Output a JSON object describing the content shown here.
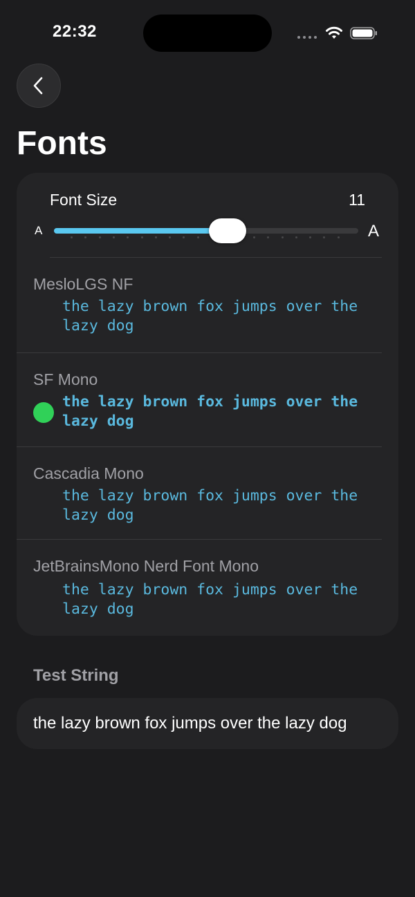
{
  "status_bar": {
    "time": "22:32"
  },
  "nav": {
    "back_icon": "chevron-left-icon",
    "title": "Fonts"
  },
  "font_size": {
    "label": "Font Size",
    "value": "11",
    "min_label": "A",
    "max_label": "A",
    "slider_fraction": 0.57,
    "accent": "#5ac8f0"
  },
  "fonts": [
    {
      "name": "MesloLGS NF",
      "sample": "the lazy brown fox jumps over the lazy dog",
      "selected": false
    },
    {
      "name": "SF Mono",
      "sample": "the lazy brown fox jumps over the lazy dog",
      "selected": true
    },
    {
      "name": "Cascadia Mono",
      "sample": "the lazy brown fox jumps over the lazy dog",
      "selected": false
    },
    {
      "name": "JetBrainsMono Nerd Font Mono",
      "sample": "the lazy brown fox jumps over the lazy dog",
      "selected": false
    }
  ],
  "selected_color": "#30d158",
  "test_string": {
    "label": "Test String",
    "value": "the lazy brown fox jumps over the lazy dog"
  }
}
